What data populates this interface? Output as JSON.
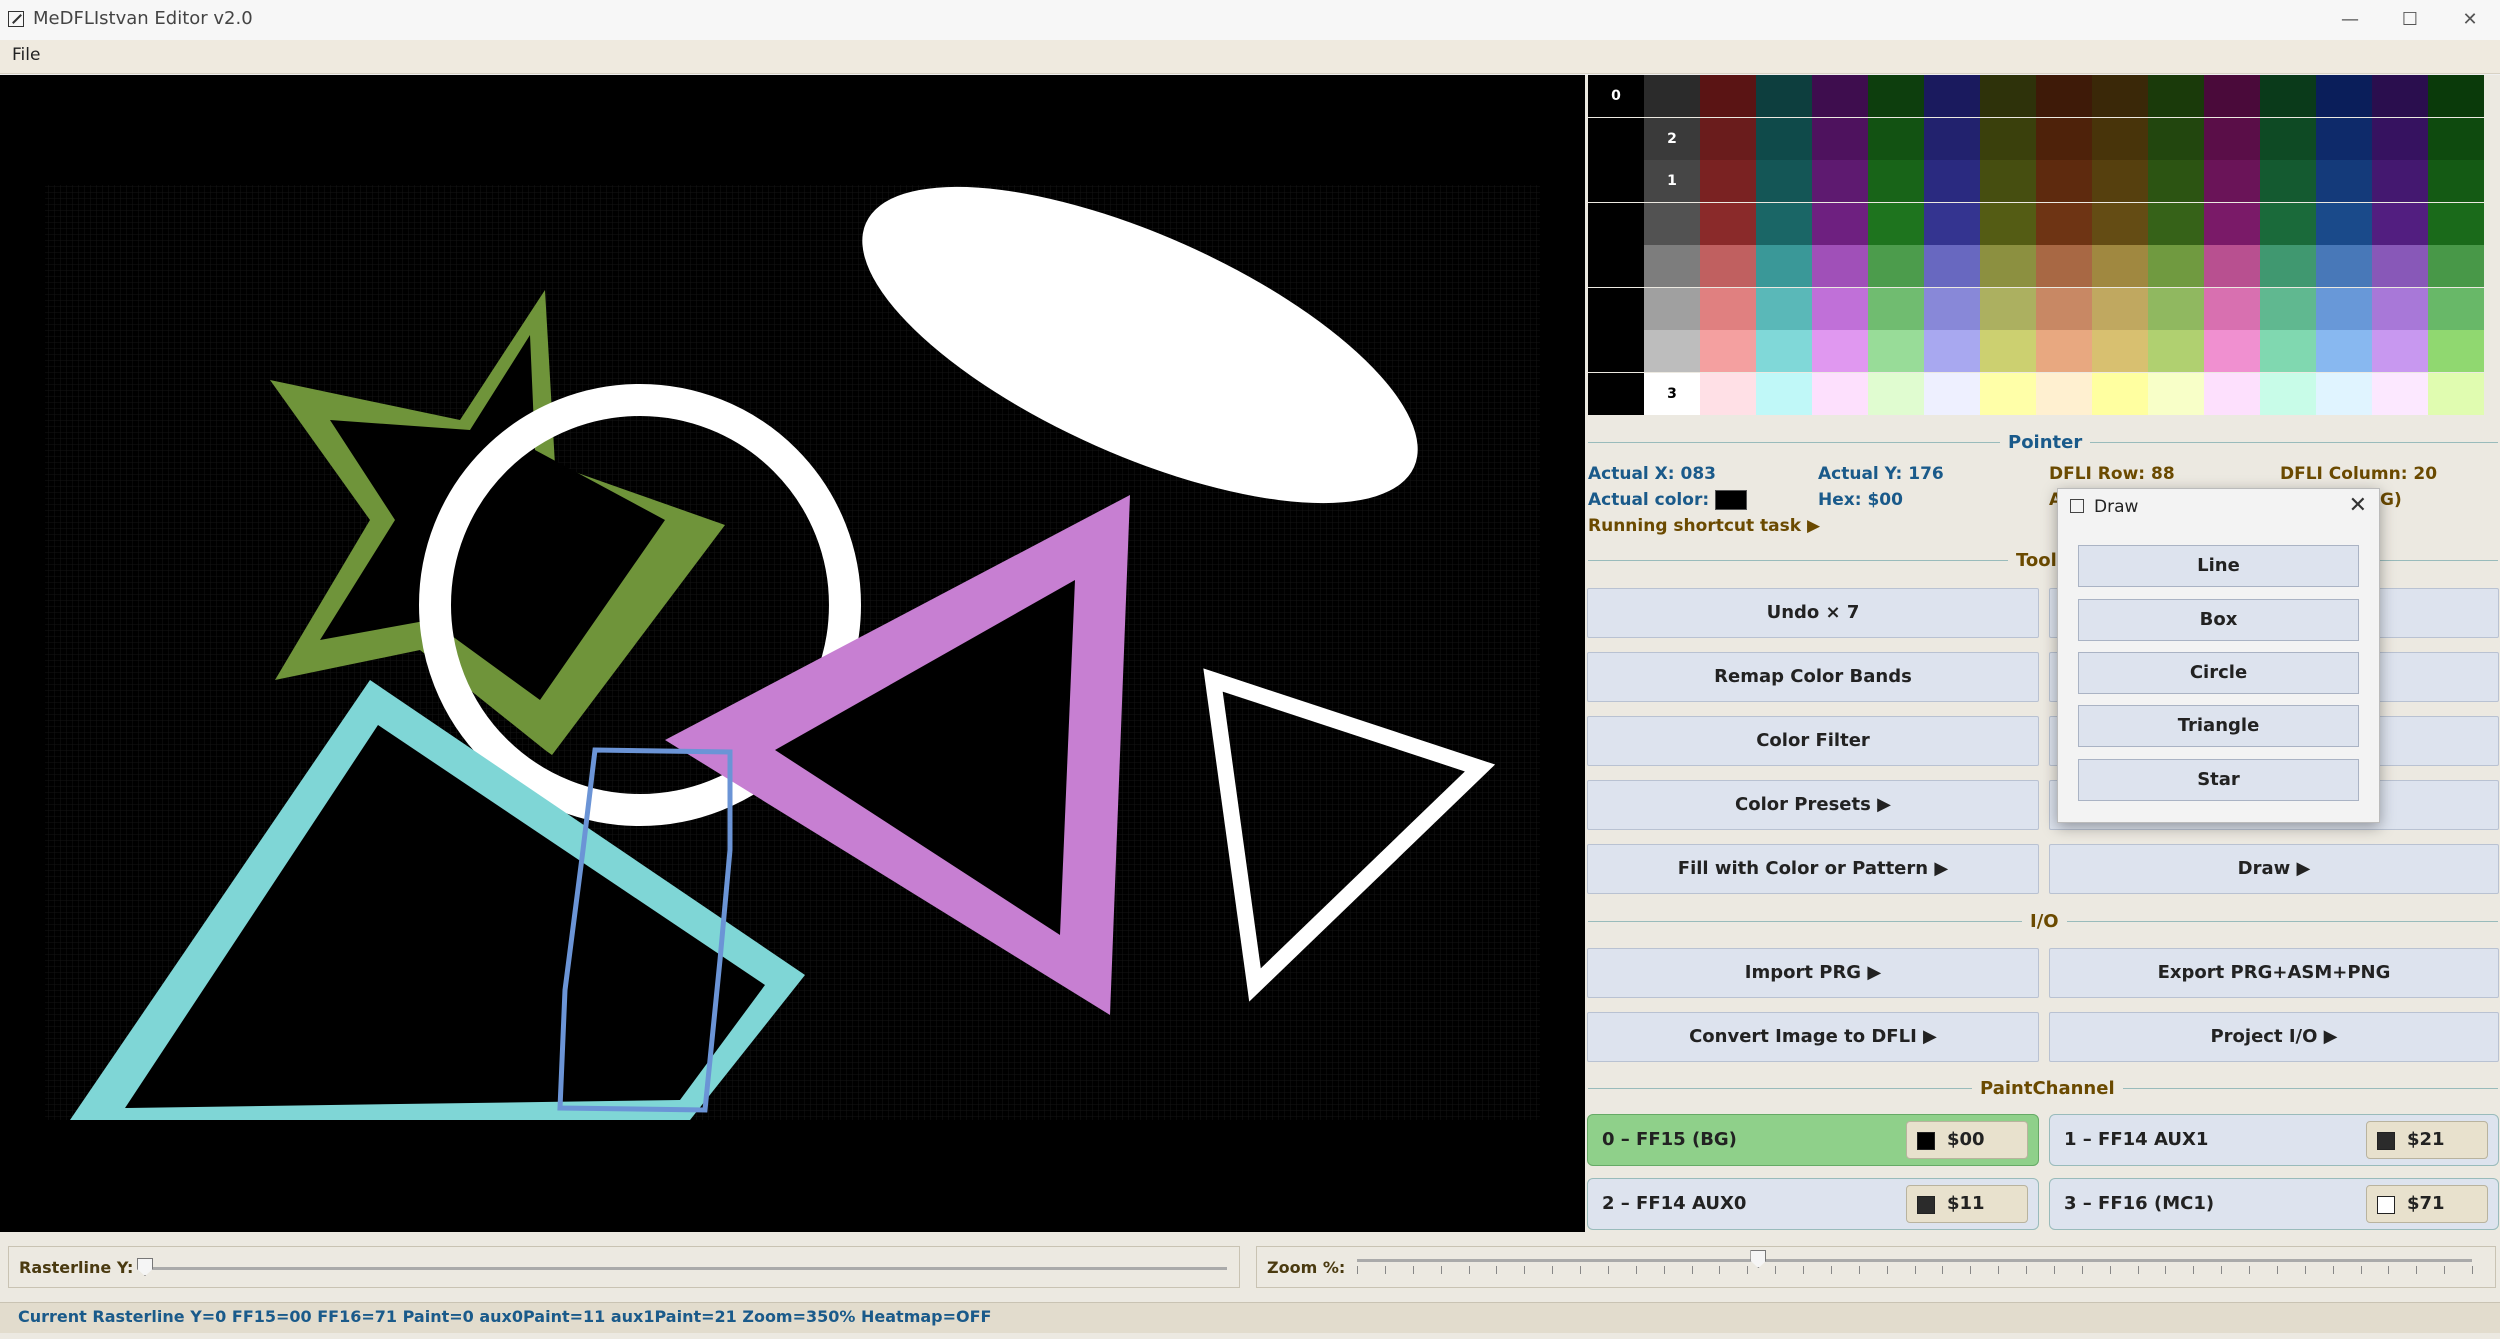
{
  "window": {
    "title": "MeDFLIstvan Editor v2.0",
    "minimize": "—",
    "maximize": "☐",
    "close": "✕"
  },
  "menu": {
    "file": "File"
  },
  "palette": {
    "columns": [
      [
        "#000000",
        "#000000",
        "#000000",
        "#000000",
        "#000000",
        "#000000",
        "#000000",
        "#000000"
      ],
      [
        "#2b2b2b",
        "#3a3a3a",
        "#464646",
        "#525252",
        "#7d7d7d",
        "#a0a0a0",
        "#bdbdbd",
        "#ffffff"
      ],
      [
        "#5a1414",
        "#6a1c1c",
        "#7a2222",
        "#8a2a2a",
        "#c06060",
        "#e08080",
        "#f4a0a0",
        "#ffe0e6"
      ],
      [
        "#0d3e3e",
        "#0f4a4a",
        "#145656",
        "#1a6666",
        "#3a9898",
        "#5ab8b8",
        "#80d8d8",
        "#c0f8f8"
      ],
      [
        "#3e0d4e",
        "#4e125e",
        "#5e1a70",
        "#6e2080",
        "#a050b8",
        "#c070d8",
        "#e098f0",
        "#fde0fd"
      ],
      [
        "#0d3e0d",
        "#125212",
        "#186418",
        "#1e741e",
        "#4c9c4c",
        "#70bc70",
        "#98dc98",
        "#e0fcd0"
      ],
      [
        "#1a1a5e",
        "#22226e",
        "#2a2a80",
        "#343490",
        "#6868c0",
        "#8888d8",
        "#a8a8f0",
        "#eef0ff"
      ],
      [
        "#2e320a",
        "#3a400c",
        "#464e10",
        "#545c14",
        "#8c9040",
        "#acb060",
        "#ccd070",
        "#ffffa8"
      ],
      [
        "#3e1a08",
        "#4e220a",
        "#5e2a0e",
        "#6e3414",
        "#a86844",
        "#c88864",
        "#e8a880",
        "#fff0d0"
      ],
      [
        "#3a2808",
        "#48340a",
        "#56400e",
        "#644c14",
        "#a08840",
        "#c0a860",
        "#d8c070",
        "#ffffa0"
      ],
      [
        "#1a3a0a",
        "#22460e",
        "#2c5412",
        "#366218",
        "#709a40",
        "#90b860",
        "#b0d070",
        "#f8ffc8"
      ],
      [
        "#4a0a3a",
        "#5a0e48",
        "#6a1458",
        "#7a1a68",
        "#b85090",
        "#d870b0",
        "#f090d0",
        "#fde0fd"
      ],
      [
        "#0a3a1a",
        "#0e4a24",
        "#145a30",
        "#1a6a3a",
        "#409870",
        "#60b890",
        "#80d8b0",
        "#c8fce8"
      ],
      [
        "#0a1e5a",
        "#0e2a6a",
        "#143a7a",
        "#1a4a8a",
        "#4878b8",
        "#6898d8",
        "#88b8f0",
        "#e0f4ff"
      ],
      [
        "#2a0e4e",
        "#361260",
        "#441870",
        "#521e80",
        "#8858b8",
        "#a878d8",
        "#c898f0",
        "#fce8ff"
      ],
      [
        "#0a3a0a",
        "#0e4a0e",
        "#145a14",
        "#1a6a1a",
        "#489848",
        "#68b868",
        "#90d870",
        "#e0fcb0"
      ]
    ],
    "markers": [
      {
        "col": 0,
        "row": 0,
        "text": "0"
      },
      {
        "col": 1,
        "row": 1,
        "text": "2"
      },
      {
        "col": 1,
        "row": 2,
        "text": "1"
      },
      {
        "col": 1,
        "row": 7,
        "text": "3"
      }
    ]
  },
  "pointer": {
    "section": "Pointer",
    "actual_x_label": "Actual X:",
    "actual_x": "083",
    "actual_y_label": "Actual Y:",
    "actual_y": "176",
    "dfli_row_label": "DFLI Row:",
    "dfli_row": "88",
    "dfli_col_label": "DFLI Column:",
    "dfli_col": "20",
    "actual_color_label": "Actual color:",
    "hex_label": "Hex:",
    "hex": "$00",
    "partial_a": "A",
    "partial_g": "G)",
    "running_task": "Running shortcut task ▶"
  },
  "tools": {
    "section": "Tool",
    "undo": "Undo × 7",
    "remap": "Remap Color Bands",
    "color_filter": "Color Filter",
    "color_presets": "Color Presets ▶",
    "fill": "Fill with Color or Pattern ▶",
    "draw": "Draw ▶"
  },
  "io": {
    "section": "I/O",
    "import_prg": "Import PRG ▶",
    "export": "Export PRG+ASM+PNG",
    "convert": "Convert Image to DFLI ▶",
    "project_io": "Project I/O ▶"
  },
  "paint_channel": {
    "section": "PaintChannel",
    "channels": [
      {
        "label": "0 – FF15 (BG)",
        "hex": "$00",
        "color": "#000000",
        "active": true
      },
      {
        "label": "1 – FF14 AUX1",
        "hex": "$21",
        "color": "#2b2b2b",
        "active": false
      },
      {
        "label": "2 – FF14 AUX0",
        "hex": "$11",
        "color": "#2b2b2b",
        "active": false
      },
      {
        "label": "3 – FF16 (MC1)",
        "hex": "$71",
        "color": "#ffffff",
        "active": false
      }
    ]
  },
  "draw_dialog": {
    "title": "Draw",
    "close": "✕",
    "options": [
      "Line",
      "Box",
      "Circle",
      "Triangle",
      "Star"
    ]
  },
  "rasterline": {
    "label": "Rasterline Y:",
    "value_fraction": 0.0
  },
  "zoom": {
    "label": "Zoom %:",
    "value_fraction": 0.36
  },
  "status": {
    "text": "Current Rasterline Y=0  FF15=00  FF16=71  Paint=0  aux0Paint=11  aux1Paint=21  Zoom=350%  Heatmap=OFF"
  },
  "colors": {
    "accent_blue": "#1a5a8a",
    "accent_brown": "#6b4a00",
    "active_green": "#8fd08a"
  }
}
